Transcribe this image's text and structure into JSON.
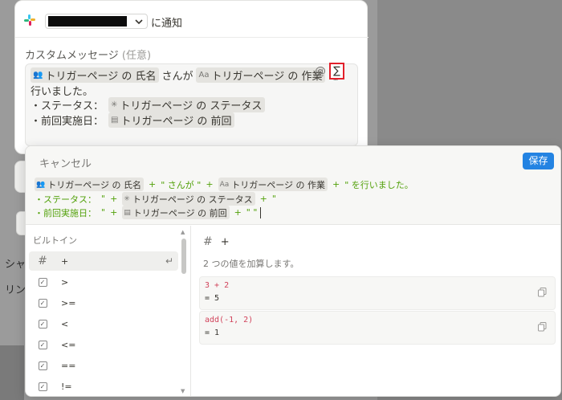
{
  "background": {
    "row1": "シャ",
    "row2": "リン"
  },
  "notify": {
    "label": "に通知",
    "message_label": "カスタムメッセージ",
    "optional": "(任意)",
    "lines": {
      "l1_chip1": "トリガーページ の 氏名",
      "l1_text1": "さんが",
      "l1_chip2": "トリガーページ の 作業",
      "l1_text2": "を",
      "l2_text": "行いました。",
      "l3_text": "・ステータス：",
      "l3_chip": "トリガーページ の ステータス",
      "l4_text": "・前回実施日：",
      "l4_chip": "トリガーページ の 前回"
    },
    "at": "@",
    "sigma": "∑",
    "aa_icon": "Aa"
  },
  "formula": {
    "cancel": "キャンセル",
    "save": "保存",
    "line1": {
      "chip1": "トリガーページ の 氏名",
      "op1": "+",
      "str1": "\" さんが \"",
      "op2": "+",
      "chip2": "トリガーページ の 作業",
      "op3": "+",
      "str2": "\" を行いました。"
    },
    "line2": {
      "str1": "・ステータス：",
      "q1": "\"",
      "op1": "+",
      "chip": "トリガーページ の ステータス",
      "op2": "+",
      "q2": "\""
    },
    "line3": {
      "str1": "・前回実施日：",
      "q1": "\"",
      "op1": "+",
      "chip": "トリガーページ の 前回",
      "op2": "+",
      "q2": "\" \""
    },
    "aa_icon": "Aa"
  },
  "sidebar": {
    "heading": "ビルトイン",
    "items": [
      {
        "icon": "hash-icon",
        "label": "+"
      },
      {
        "icon": "checkbox-icon",
        "label": ">"
      },
      {
        "icon": "checkbox-icon",
        "label": ">="
      },
      {
        "icon": "checkbox-icon",
        "label": "<"
      },
      {
        "icon": "checkbox-icon",
        "label": "<="
      },
      {
        "icon": "checkbox-icon",
        "label": "=="
      },
      {
        "icon": "checkbox-icon",
        "label": "!="
      }
    ]
  },
  "detail": {
    "title": "+",
    "description": "2 つの値を加算します。",
    "examples": [
      {
        "code": "3 + 2",
        "result": "= 5"
      },
      {
        "code": "add(-1, 2)",
        "result": "= 1"
      }
    ]
  },
  "colors": {
    "accent": "#2383e2",
    "highlight_border": "#e2202b",
    "string_green": "#52a10a",
    "code_red": "#d1435b"
  }
}
